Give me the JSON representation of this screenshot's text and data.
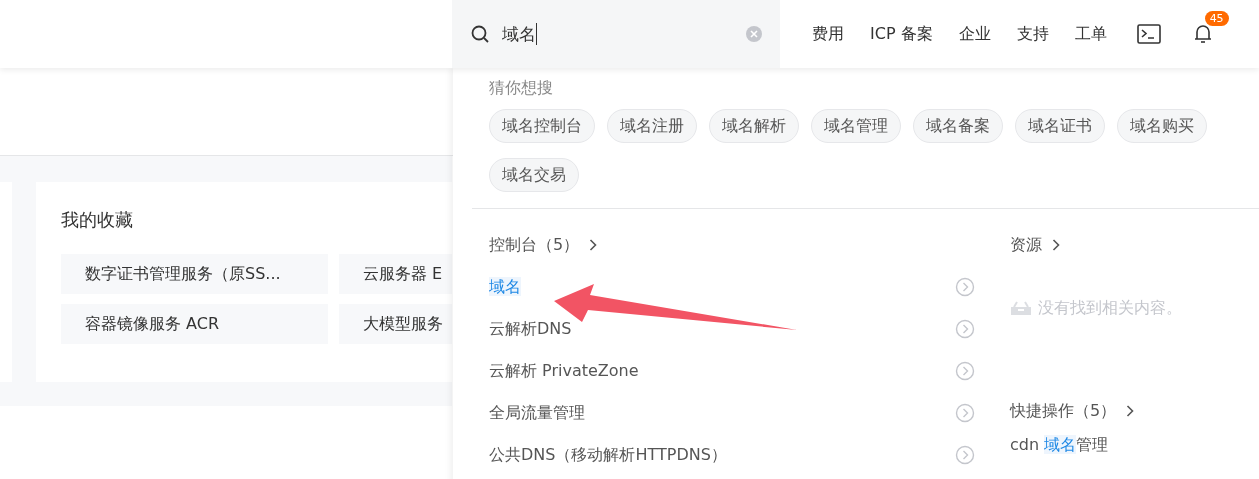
{
  "search": {
    "value": "域名"
  },
  "nav": [
    "费用",
    "ICP 备案",
    "企业",
    "支持",
    "工单"
  ],
  "notifications": {
    "badge": "45"
  },
  "favorites": {
    "title": "我的收藏",
    "items": [
      "数字证书管理服务（原SS...",
      "云服务器 E",
      "容器镜像服务 ACR",
      "大模型服务"
    ]
  },
  "dropdown": {
    "suggest_title": "猜你想搜",
    "chips": [
      "域名控制台",
      "域名注册",
      "域名解析",
      "域名管理",
      "域名备案",
      "域名证书",
      "域名购买",
      "域名交易"
    ],
    "console": {
      "title": "控制台（5）",
      "items": [
        {
          "parts": [
            {
              "text": "域名",
              "highlight": true
            }
          ]
        },
        {
          "parts": [
            {
              "text": "云解析DNS",
              "highlight": false
            }
          ]
        },
        {
          "parts": [
            {
              "text": "云解析 PrivateZone",
              "highlight": false
            }
          ]
        },
        {
          "parts": [
            {
              "text": "全局流量管理",
              "highlight": false
            }
          ]
        },
        {
          "parts": [
            {
              "text": "公共DNS（移动解析HTTPDNS）",
              "highlight": false
            }
          ]
        }
      ]
    },
    "resources": {
      "title": "资源",
      "empty": "没有找到相关内容。"
    },
    "quick": {
      "title": "快捷操作（5）",
      "items": [
        {
          "parts": [
            {
              "text": "cdn ",
              "highlight": false
            },
            {
              "text": "域名",
              "highlight": true
            },
            {
              "text": "管理",
              "highlight": false
            }
          ]
        }
      ]
    }
  }
}
